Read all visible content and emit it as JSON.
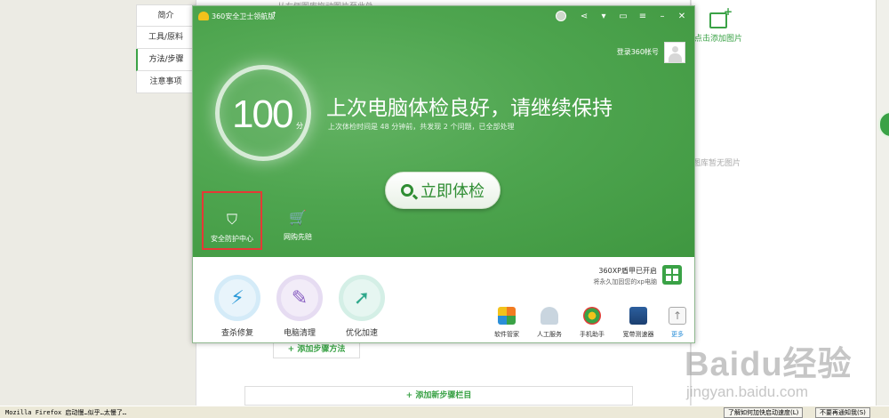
{
  "background": {
    "sidenav": [
      "简介",
      "工具/原料",
      "方法/步骤",
      "注意事项"
    ],
    "top_note": "从右侧图库拖动图片至此处",
    "add_image_label": "点击添加图片",
    "no_image_label": "图库暂无图片",
    "add_step_method": "+ 添加步骤方法",
    "add_new_step": "+ 添加新步骤栏目"
  },
  "watermark": {
    "logo": "Baidu经验",
    "url": "jingyan.baidu.com"
  },
  "window": {
    "title": "360安全卫士领航版",
    "title_icons": [
      "medal-icon",
      "share-icon",
      "skin-icon",
      "feedback-icon",
      "menu-icon",
      "minimize-icon",
      "close-icon"
    ],
    "login": "登录360帐号",
    "score": "100",
    "score_unit": "分",
    "headline": "上次电脑体检良好，请继续保持",
    "subline": "上次体检时间是 48 分钟前，共发现 2 个问题，已全部处理",
    "check_button": "立即体检",
    "features": [
      "安全防护中心",
      "网购先赔"
    ],
    "xp_title": "360XP盾甲已开启",
    "xp_sub": "将永久加固您的xp电脑",
    "big_tools": [
      "查杀修复",
      "电脑清理",
      "优化加速"
    ],
    "small_tools": [
      "软件管家",
      "人工服务",
      "手机助手",
      "宽带测速器",
      "更多"
    ],
    "colors": {
      "primary_green": "#4ea54f",
      "highlight_red": "#e53935"
    }
  },
  "taskbar": {
    "task": "Mozilla Firefox 启动慢…似乎…太慢了…",
    "btn1": "了解如何加快启动速度(L)",
    "btn2": "不要再通知我(S)"
  }
}
